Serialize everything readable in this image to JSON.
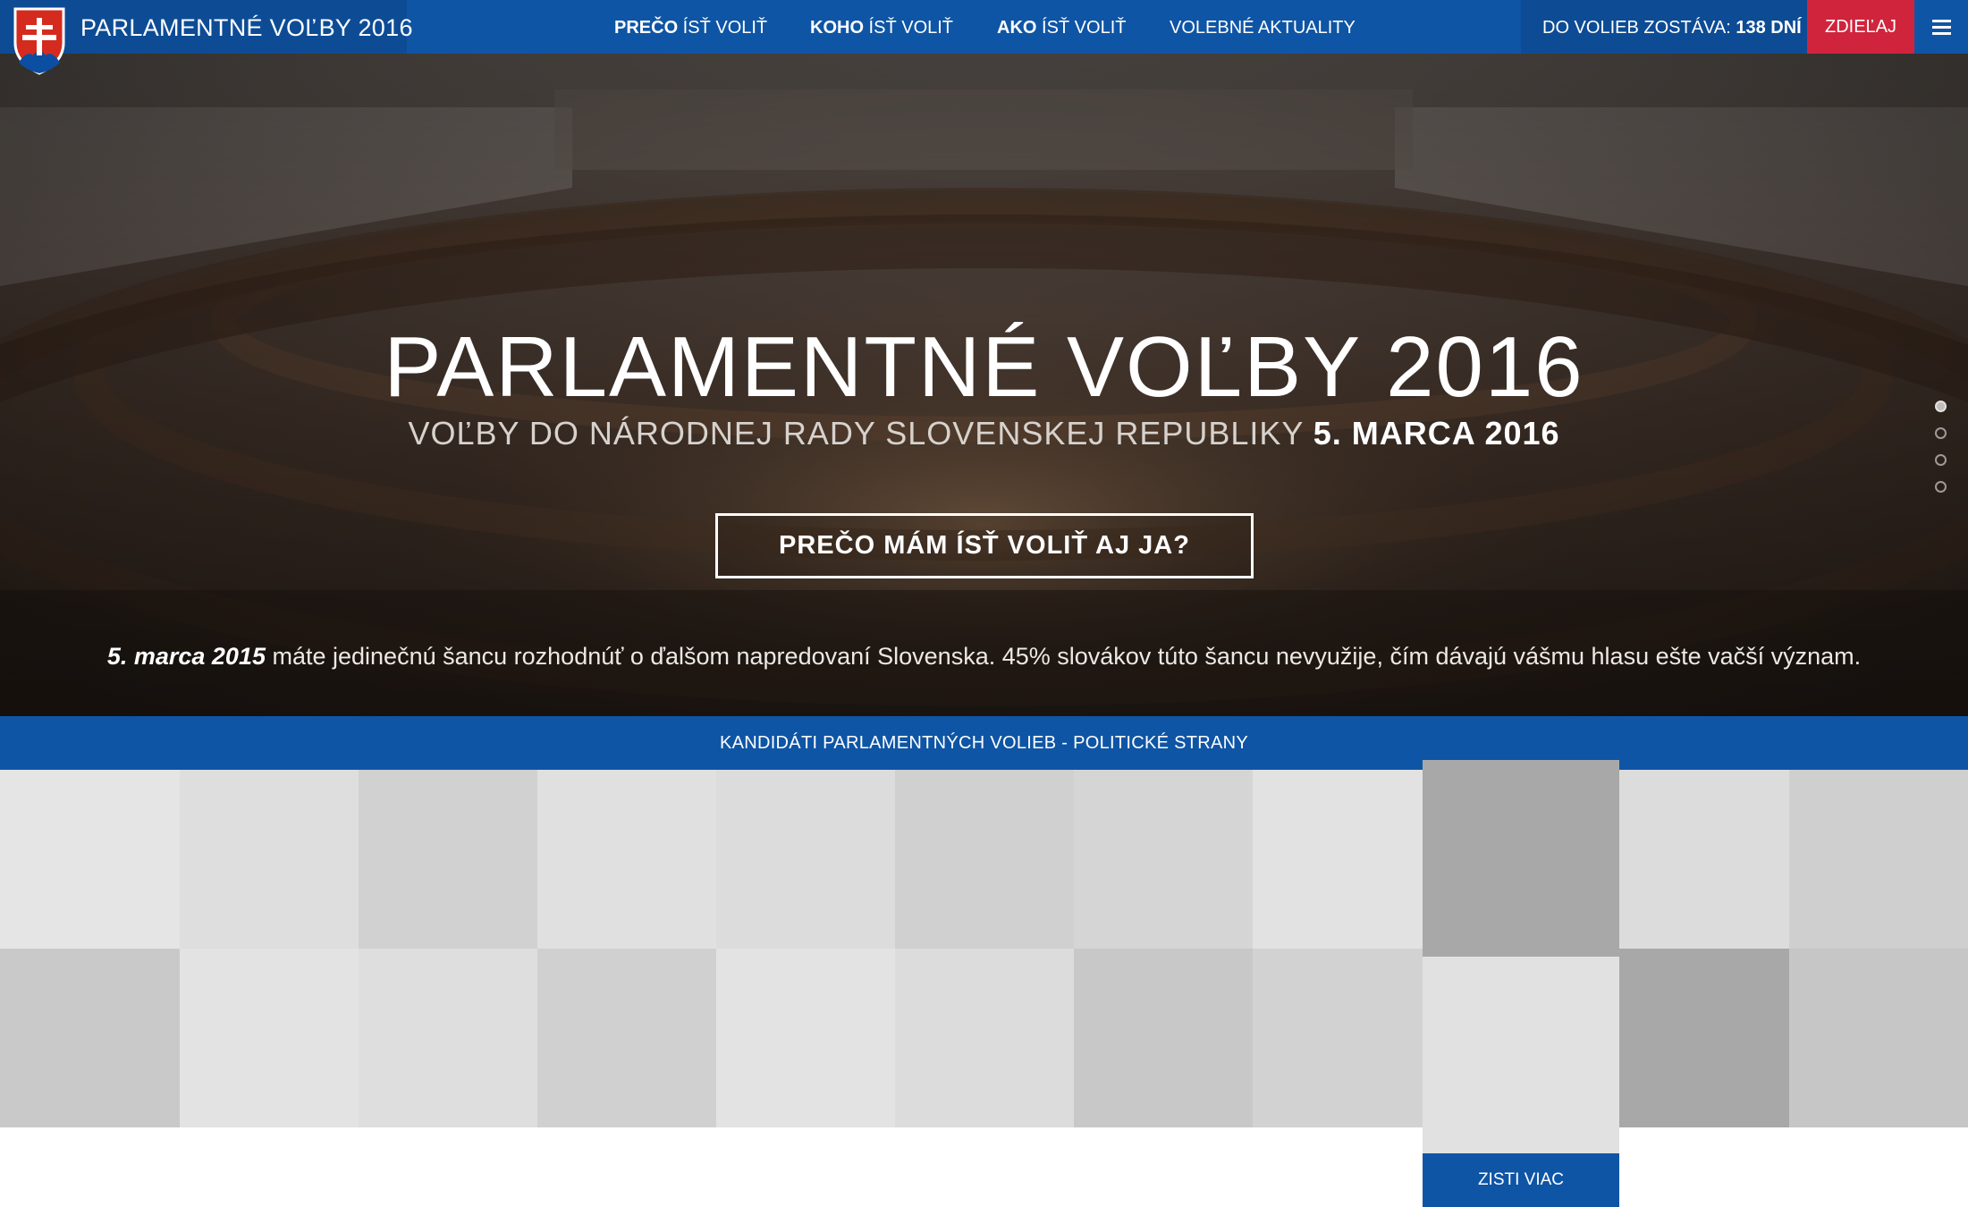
{
  "header": {
    "brand_title": "PARLAMENTNÉ VOĽBY 2016",
    "nav": [
      {
        "bold": "PREČO",
        "rest": " ÍSŤ VOLIŤ"
      },
      {
        "bold": "KOHO",
        "rest": " ÍSŤ VOLIŤ"
      },
      {
        "bold": "AKO",
        "rest": " ÍSŤ VOLIŤ"
      },
      {
        "bold": "",
        "rest": "VOLEBNÉ AKTUALITY"
      }
    ],
    "countdown_label": "DO VOLIEB ZOSTÁVA: ",
    "countdown_value": "138 DNÍ",
    "share_label": "ZDIEĽAJ",
    "menu_icon": "hamburger-icon",
    "crest_icon": "slovak-coat-of-arms-icon"
  },
  "hero": {
    "title": "PARLAMENTNÉ VOĽBY 2016",
    "subtitle_lead": "VOĽBY DO NÁRODNEJ RADY SLOVENSKEJ REPUBLIKY ",
    "subtitle_date": "5. MARCA 2016",
    "cta_label": "PREČO MÁM ÍSŤ VOLIŤ AJ JA?",
    "text_date": "5. marca 2015",
    "text_body": " máte jedinečnú šancu rozhodnúť o ďalšom napredovaní Slovenska. 45% slovákov túto šancu nevyužije, čím dávajú vášmu hlasu ešte vačší význam.",
    "slides": 4,
    "active_slide": 1
  },
  "parties": {
    "bar_label": "KANDIDÁTI PARLAMENTNÝCH VOLIEB - POLITICKÉ STRANY",
    "more_label": "ZISTI VIAC",
    "tile_colors_row1": [
      "#e5e5e5",
      "#dedede",
      "#d1d1d1",
      "#e0e0e0",
      "#dcdcdc",
      "#d0d0d0",
      "#d5d5d5",
      "#e2e2e2",
      "#a8a8a8",
      "#dcdcdc",
      "#cfcfcf"
    ],
    "tile_colors_row2": [
      "#c9c9c9",
      "#e3e3e3",
      "#dedede",
      "#d0d0d0",
      "#e3e3e3",
      "#dcdcdc",
      "#c8c8c8",
      "#d2d2d2",
      "#e1e1e1",
      "#a8a8a8",
      "#c6c6c6"
    ]
  },
  "colors": {
    "primary_blue": "#0f55a5",
    "dark_blue": "#0d4c95",
    "share_red": "#d0243d"
  }
}
